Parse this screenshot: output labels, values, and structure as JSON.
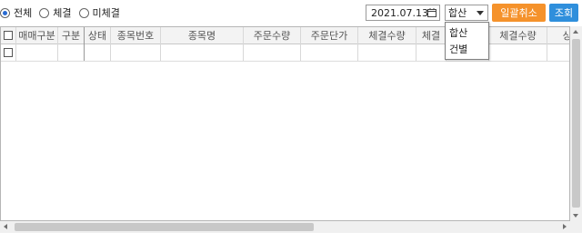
{
  "filter": {
    "radios": [
      {
        "label": "전체",
        "selected": true
      },
      {
        "label": "체결",
        "selected": false
      },
      {
        "label": "미체결",
        "selected": false
      }
    ],
    "date": "2021.07.13",
    "date_icon": "calendar-icon",
    "view_select": {
      "value": "합산",
      "options": [
        "합산",
        "건별"
      ]
    },
    "cancel_all_label": "일괄취소",
    "query_label": "조회"
  },
  "grid": {
    "columns": [
      "매매구분",
      "구분",
      "상태",
      "종목번호",
      "종목명",
      "주문수량",
      "주문단가",
      "체결수량",
      "체결",
      "체결수량",
      "상품"
    ]
  },
  "colors": {
    "orange_button": "#f5922b",
    "blue_button": "#2f8fdc",
    "radio_selected": "#2a6bd1"
  }
}
